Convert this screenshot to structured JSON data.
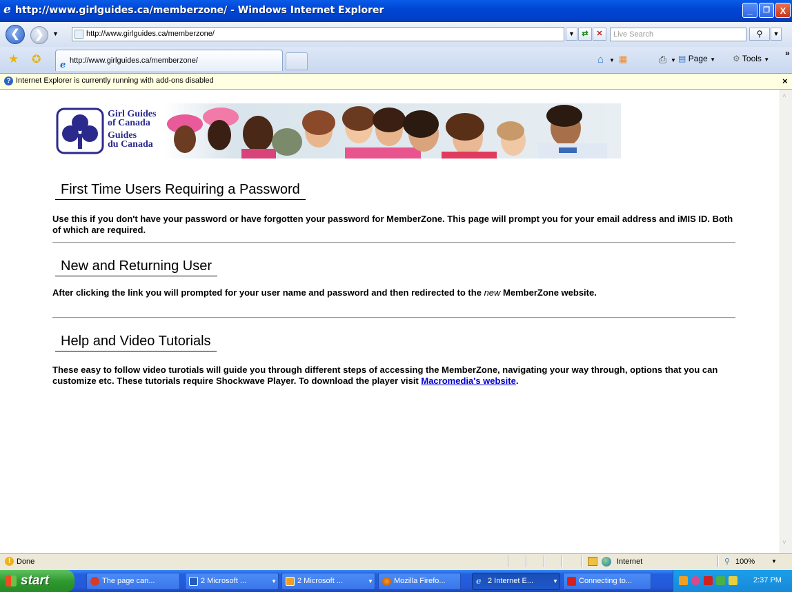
{
  "window": {
    "title": "http://www.girlguides.ca/memberzone/ - Windows Internet Explorer",
    "min": "_",
    "max": "❐",
    "close": "X"
  },
  "address": {
    "url": "http://www.girlguides.ca/memberzone/",
    "search_placeholder": "Live Search"
  },
  "tab": {
    "label": "http://www.girlguides.ca/memberzone/"
  },
  "commandbar": {
    "page": "Page",
    "tools": "Tools"
  },
  "infobar": {
    "text": "Internet Explorer is currently running with add-ons disabled",
    "close": "×"
  },
  "logo": {
    "line1": "Girl Guides",
    "line2": "of Canada",
    "line3": "Guides",
    "line4": "du Canada"
  },
  "sections": [
    {
      "title": "First Time Users Requiring a Password",
      "text": "Use this if you don't have your password or have forgotten your password for MemberZone. This page will prompt you for your email address and iMIS ID. Both of which are required."
    },
    {
      "title": "New and Returning User",
      "text_before": "After clicking the link you will prompted for your user name and password and then redirected to the ",
      "text_em": "new",
      "text_after": " MemberZone website."
    },
    {
      "title": "Help and Video Tutorials",
      "text": "These easy to follow video turotials will guide you through different steps of accessing the MemberZone, navigating your way through, options that you can customize etc. These tutorials require Shockwave Player. To download the player visit ",
      "link": "Macromedia's website",
      "text_end": "."
    }
  ],
  "status": {
    "text": "Done",
    "zone": "Internet",
    "zoom": "100%"
  },
  "taskbar": {
    "start": "start",
    "tasks": [
      "The page can...",
      "2 Microsoft ...",
      "2 Microsoft ...",
      "Mozilla Firefo...",
      "2 Internet E...",
      "Connecting to..."
    ],
    "clock": "2:37 PM"
  },
  "colors": {
    "titlebar": "#0046d5",
    "link": "#0000cc",
    "infobar": "#ffffe1",
    "taskbar": "#2458d8",
    "start": "#2f9a2f"
  }
}
